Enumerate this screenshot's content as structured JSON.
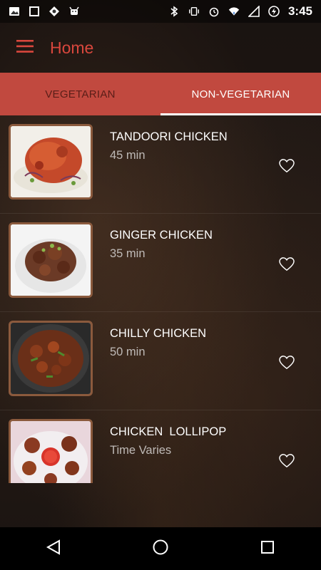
{
  "status_bar": {
    "time": "3:45",
    "left_icons": [
      "photo-icon",
      "square-icon",
      "location-icon",
      "android-icon"
    ],
    "right_icons": [
      "bluetooth-icon",
      "vibrate-icon",
      "alarm-icon",
      "wifi-icon",
      "signal-icon",
      "battery-icon"
    ]
  },
  "app_bar": {
    "title": "Home",
    "menu_icon": "hamburger-menu-icon",
    "accent": "#d9473d"
  },
  "tabs": [
    {
      "label": "VEGETARIAN",
      "active": false
    },
    {
      "label": "NON-VEGETARIAN",
      "active": true
    }
  ],
  "colors": {
    "tab_background": "#c1493f",
    "thumb_border": "#8b5a3d"
  },
  "recipes": [
    {
      "title": "TANDOORI CHICKEN",
      "time": "45 min",
      "favorite_icon": "heart-outline-icon"
    },
    {
      "title": "GINGER CHICKEN",
      "time": "35 min",
      "favorite_icon": "heart-outline-icon"
    },
    {
      "title": "CHILLY CHICKEN",
      "time": "50 min",
      "favorite_icon": "heart-outline-icon"
    },
    {
      "title": "CHICKEN  LOLLIPOP",
      "time": "Time Varies",
      "favorite_icon": "heart-outline-icon"
    }
  ],
  "nav_bar": {
    "buttons": [
      "back-icon",
      "home-icon",
      "recents-icon"
    ]
  }
}
